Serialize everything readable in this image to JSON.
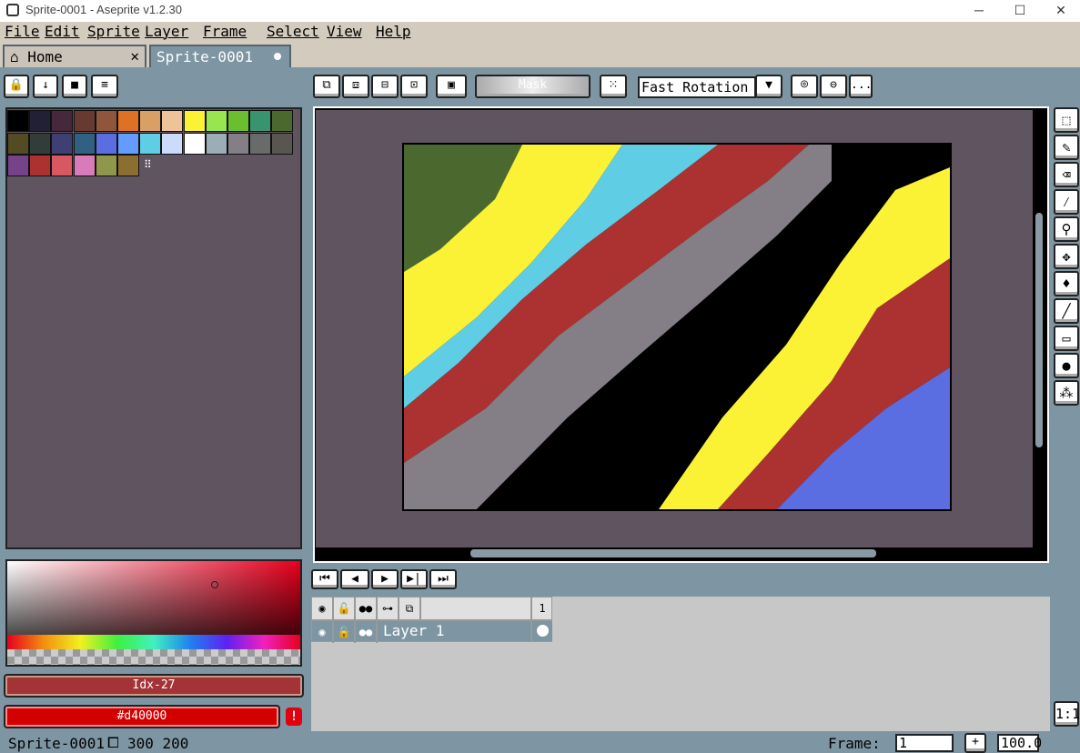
{
  "window": {
    "title": "Sprite-0001 - Aseprite v1.2.30",
    "minimize": "─",
    "maximize": "☐",
    "close": "✕"
  },
  "menu": [
    "File",
    "Edit",
    "Sprite",
    "Layer",
    "Frame",
    "Select",
    "View",
    "Help"
  ],
  "tabs": [
    {
      "label": "Home",
      "close": "✕"
    },
    {
      "label": "Sprite-0001"
    }
  ],
  "context_bar": {
    "mask_label": "Mask",
    "rotation_algorithm": "Fast Rotation",
    "more": "..."
  },
  "palette": {
    "colors": [
      "#000000",
      "#222034",
      "#45283c",
      "#663931",
      "#8f563b",
      "#df7126",
      "#d9a066",
      "#eec39a",
      "#fbf236",
      "#99e550",
      "#6abe30",
      "#37946e",
      "#4b692f",
      "#524b24",
      "#323c39",
      "#3f3f74",
      "#306082",
      "#5b6ee1",
      "#639bff",
      "#5fcde4",
      "#cbdbfc",
      "#ffffff",
      "#9badb7",
      "#847e87",
      "#696a6a",
      "#595652",
      "#76428a",
      "#ac3232",
      "#d95763",
      "#d77bba",
      "#8f974a",
      "#8a6f30"
    ],
    "extra_marker": "⠿"
  },
  "color_bar": {
    "index_label": "Idx-27",
    "hex_label": "#d40000",
    "warning": "!"
  },
  "animation_controls": [
    "⏮",
    "◀",
    "▶",
    "▶|",
    "⏭"
  ],
  "timeline": {
    "frame_number": "1",
    "layer_name": "Layer 1"
  },
  "tools": [
    "marquee",
    "pencil",
    "eraser",
    "eyedropper",
    "zoom",
    "move",
    "paint-bucket",
    "line",
    "rectangle",
    "contour",
    "blur"
  ],
  "tools_footer": "1:1",
  "status": {
    "sprite": "Sprite-0001",
    "size": "300 200",
    "frame_label": "Frame:",
    "frame_value": "1",
    "zoom": "100.0"
  },
  "canvas_stripes": [
    {
      "color": "#4b692f"
    },
    {
      "color": "#fbf236"
    },
    {
      "color": "#5fcde4"
    },
    {
      "color": "#ac3232"
    },
    {
      "color": "#847e87"
    },
    {
      "color": "#000000"
    },
    {
      "color": "#fbf236"
    },
    {
      "color": "#ac3232"
    },
    {
      "color": "#5b6ee1"
    }
  ]
}
